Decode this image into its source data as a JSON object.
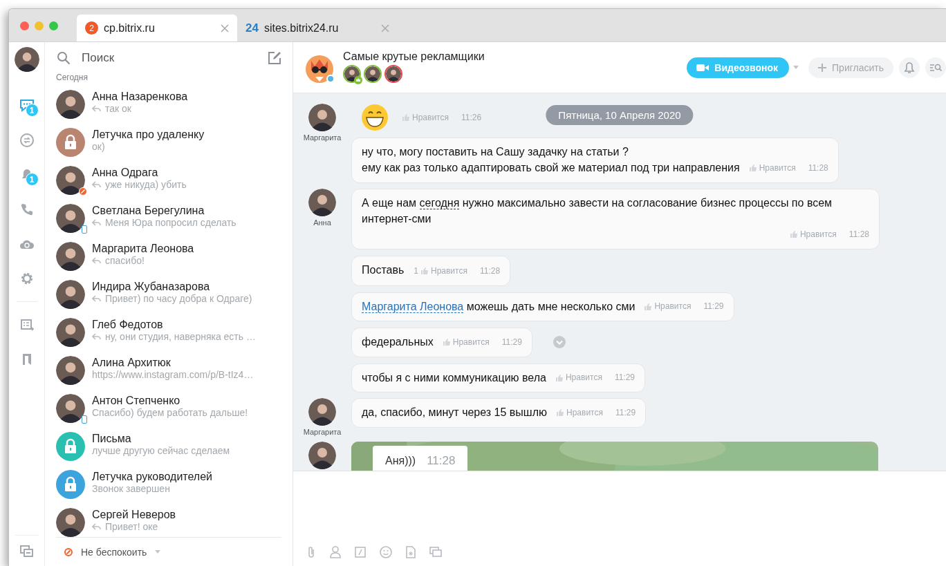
{
  "tabs": [
    {
      "label": "cp.bitrix.ru",
      "badge": "2",
      "selected": true
    },
    {
      "label": "sites.bitrix24.ru",
      "prefix": "24",
      "selected": false
    }
  ],
  "rail": {
    "items": [
      {
        "kind": "chats",
        "badge": "1",
        "selected": true
      },
      {
        "kind": "channels",
        "selected": false
      },
      {
        "kind": "notifications",
        "badge": "1",
        "selected": false
      },
      {
        "kind": "calls",
        "selected": false
      },
      {
        "kind": "disk",
        "selected": false
      },
      {
        "kind": "settings",
        "selected": false
      },
      {
        "kind": "tasks",
        "selected": false
      },
      {
        "kind": "bookmarks",
        "selected": false
      }
    ]
  },
  "chat_list": {
    "search": {
      "placeholder": "Поиск"
    },
    "section": "Сегодня",
    "items": [
      {
        "name": "Анна Назаренкова",
        "preview": "так ок",
        "reply": true
      },
      {
        "kind": "lock",
        "name": "Летучка про удаленку",
        "preview": "ок)",
        "reply": false,
        "color": "#b98570"
      },
      {
        "name": "Анна Одрага",
        "preview": "уже никуда) убить",
        "reply": true,
        "dnd": true
      },
      {
        "name": "Светлана Берегулина",
        "preview": "Меня Юра попросил сделать",
        "reply": true,
        "mobile": true
      },
      {
        "name": "Маргарита Леонова",
        "preview": "спасибо!",
        "reply": true
      },
      {
        "name": "Индира Жубаназарова",
        "preview": "Привет) по часу добра к Одраге)",
        "reply": true
      },
      {
        "name": "Глеб Федотов",
        "preview": "ну, они студия, наверняка есть …",
        "reply": true
      },
      {
        "name": "Алина Архитюк",
        "preview": "https://www.instagram.com/p/B-tIz4…",
        "reply": false
      },
      {
        "name": "Антон Степченко",
        "preview": "Спасибо) будем работать дальше!",
        "reply": false,
        "mobile": true
      },
      {
        "kind": "lock",
        "name": "Письма",
        "preview": "лучше другую сейчас сделаем",
        "reply": false,
        "color": "#29c0b1"
      },
      {
        "kind": "lock",
        "name": "Летучка руководителей",
        "preview": "Звонок завершен",
        "reply": false,
        "color": "#3ca3dd"
      },
      {
        "name": "Сергей Неверов",
        "preview": "Привет! оке",
        "reply": true
      }
    ],
    "status": "Не беспокоить"
  },
  "chat": {
    "title": "Самые крутые рекламщики",
    "members": [
      {
        "color": "#7fc03b",
        "owner": true
      },
      {
        "color": "#7fc03b",
        "owner": false
      },
      {
        "color": "#e5484d",
        "owner": false
      }
    ],
    "video_call": "Видеозвонок",
    "invite": "Пригласить",
    "date": "Пятница, 10 Апреля 2020",
    "groups": [
      {
        "author": "Маргарита",
        "messages": [
          {
            "kind": "emoji",
            "like": "Нравится",
            "time": "11:26"
          },
          {
            "kind": "text",
            "lines": [
              [
                {
                  "kind": "plain",
                  "text": "ну что, могу поставить на Сашу задачку на статьи ?"
                }
              ],
              [
                {
                  "kind": "plain",
                  "text": "ему как раз только адаптировать свой же материал под три направления"
                }
              ]
            ],
            "like": "Нравится",
            "time": "11:28"
          }
        ]
      },
      {
        "author": "Анна",
        "messages": [
          {
            "kind": "text",
            "lines": [
              [
                {
                  "kind": "plain",
                  "text": "А еще нам "
                },
                {
                  "kind": "date",
                  "text": "сегодня"
                },
                {
                  "kind": "plain",
                  "text": " нужно максимально завести на согласование бизнес процессы по всем интернет-сми"
                }
              ]
            ],
            "like": "Нравится",
            "time": "11:28"
          },
          {
            "kind": "text",
            "lines": [
              [
                {
                  "kind": "plain",
                  "text": "Поставь"
                }
              ]
            ],
            "likes": "1",
            "like": "Нравится",
            "time": "11:28"
          },
          {
            "kind": "text",
            "lines": [
              [
                {
                  "kind": "mention",
                  "text": "Маргарита Леонова"
                },
                {
                  "kind": "plain",
                  "text": " можешь дать мне несколько сми"
                }
              ]
            ],
            "like": "Нравится",
            "time": "11:29"
          },
          {
            "kind": "text",
            "lines": [
              [
                {
                  "kind": "plain",
                  "text": "федеральных"
                }
              ]
            ],
            "like": "Нравится",
            "time": "11:29",
            "menu": true
          },
          {
            "kind": "text",
            "lines": [
              [
                {
                  "kind": "plain",
                  "text": "чтобы я с ними коммуникацию вела"
                }
              ]
            ],
            "like": "Нравится",
            "time": "11:29"
          }
        ]
      },
      {
        "author": "Маргарита",
        "messages": [
          {
            "kind": "text",
            "lines": [
              [
                {
                  "kind": "plain",
                  "text": "да, спасибо, минут через 15 вышлю"
                }
              ]
            ],
            "like": "Нравится",
            "time": "11:29"
          }
        ]
      },
      {
        "messages": [
          {
            "caption": "Аня)))",
            "time": "11:28"
          }
        ]
      }
    ]
  }
}
